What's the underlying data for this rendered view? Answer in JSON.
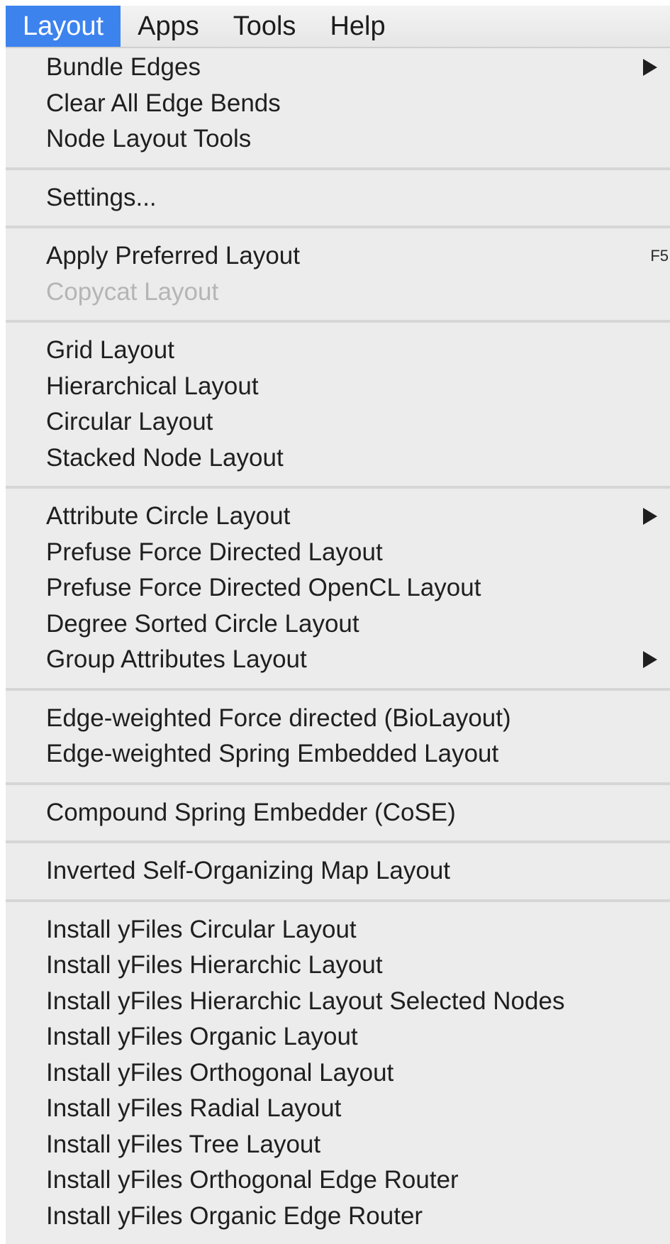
{
  "menubar": {
    "items": [
      {
        "label": "Layout",
        "active": true
      },
      {
        "label": "Apps",
        "active": false
      },
      {
        "label": "Tools",
        "active": false
      },
      {
        "label": "Help",
        "active": false
      }
    ]
  },
  "menu": {
    "groups": [
      {
        "items": [
          {
            "label": "Bundle Edges",
            "submenu": true
          },
          {
            "label": "Clear All Edge Bends"
          },
          {
            "label": "Node Layout Tools"
          }
        ]
      },
      {
        "items": [
          {
            "label": "Settings..."
          }
        ]
      },
      {
        "items": [
          {
            "label": "Apply Preferred Layout",
            "shortcut": "F5"
          },
          {
            "label": "Copycat Layout",
            "disabled": true
          }
        ]
      },
      {
        "items": [
          {
            "label": "Grid Layout"
          },
          {
            "label": "Hierarchical Layout"
          },
          {
            "label": "Circular Layout"
          },
          {
            "label": "Stacked Node Layout"
          }
        ]
      },
      {
        "items": [
          {
            "label": "Attribute Circle Layout",
            "submenu": true
          },
          {
            "label": "Prefuse Force Directed Layout"
          },
          {
            "label": "Prefuse Force Directed OpenCL Layout"
          },
          {
            "label": "Degree Sorted Circle Layout"
          },
          {
            "label": "Group Attributes Layout",
            "submenu": true
          }
        ]
      },
      {
        "items": [
          {
            "label": "Edge-weighted Force directed (BioLayout)"
          },
          {
            "label": "Edge-weighted Spring Embedded Layout"
          }
        ]
      },
      {
        "items": [
          {
            "label": "Compound Spring Embedder (CoSE)"
          }
        ]
      },
      {
        "items": [
          {
            "label": "Inverted Self-Organizing Map Layout"
          }
        ]
      },
      {
        "items": [
          {
            "label": "Install yFiles Circular Layout"
          },
          {
            "label": "Install yFiles Hierarchic Layout"
          },
          {
            "label": "Install yFiles Hierarchic Layout Selected Nodes"
          },
          {
            "label": "Install yFiles Organic Layout"
          },
          {
            "label": "Install yFiles Orthogonal Layout"
          },
          {
            "label": "Install yFiles Radial Layout"
          },
          {
            "label": "Install yFiles Tree Layout"
          },
          {
            "label": "Install yFiles Orthogonal Edge Router"
          },
          {
            "label": "Install yFiles Organic Edge Router"
          }
        ]
      }
    ]
  },
  "colors": {
    "highlight": "#3d83ee",
    "menu_background": "#ececec",
    "disabled_text": "#b5b5b5"
  },
  "icons": {
    "submenu": "submenu-arrow-icon"
  }
}
